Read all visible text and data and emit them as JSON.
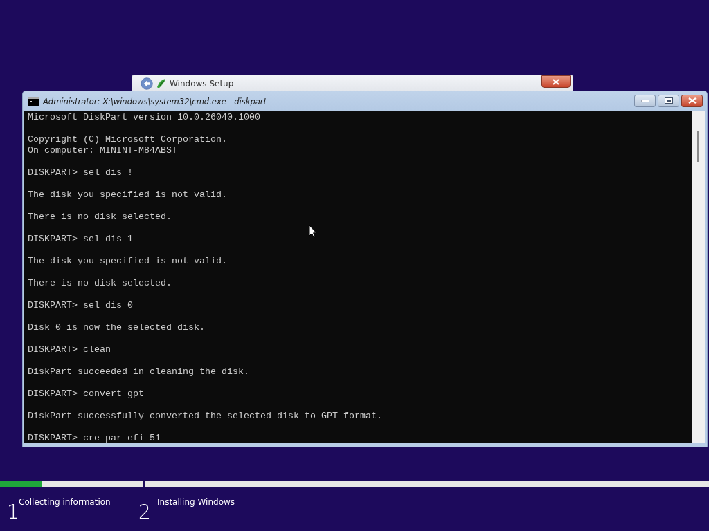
{
  "setup_window": {
    "title": "Windows Setup"
  },
  "console_window": {
    "title": "Administrator: X:\\windows\\system32\\cmd.exe - diskpart",
    "paragraphs": [
      [
        "Microsoft DiskPart version 10.0.26040.1000"
      ],
      [
        "Copyright (C) Microsoft Corporation.",
        "On computer: MININT-M84ABST"
      ],
      [
        "DISKPART> sel dis !"
      ],
      [
        "The disk you specified is not valid."
      ],
      [
        "There is no disk selected."
      ],
      [
        "DISKPART> sel dis 1"
      ],
      [
        "The disk you specified is not valid."
      ],
      [
        "There is no disk selected."
      ],
      [
        "DISKPART> sel dis 0"
      ],
      [
        "Disk 0 is now the selected disk."
      ],
      [
        "DISKPART> clean"
      ],
      [
        "DiskPart succeeded in cleaning the disk."
      ],
      [
        "DISKPART> convert gpt"
      ],
      [
        "DiskPart successfully converted the selected disk to GPT format."
      ],
      [
        "DISKPART> cre par efi 51"
      ]
    ]
  },
  "steps": [
    {
      "number": "1",
      "label": "Collecting information",
      "level": 0.29
    },
    {
      "number": "2",
      "label": "Installing Windows",
      "level": 0
    }
  ]
}
